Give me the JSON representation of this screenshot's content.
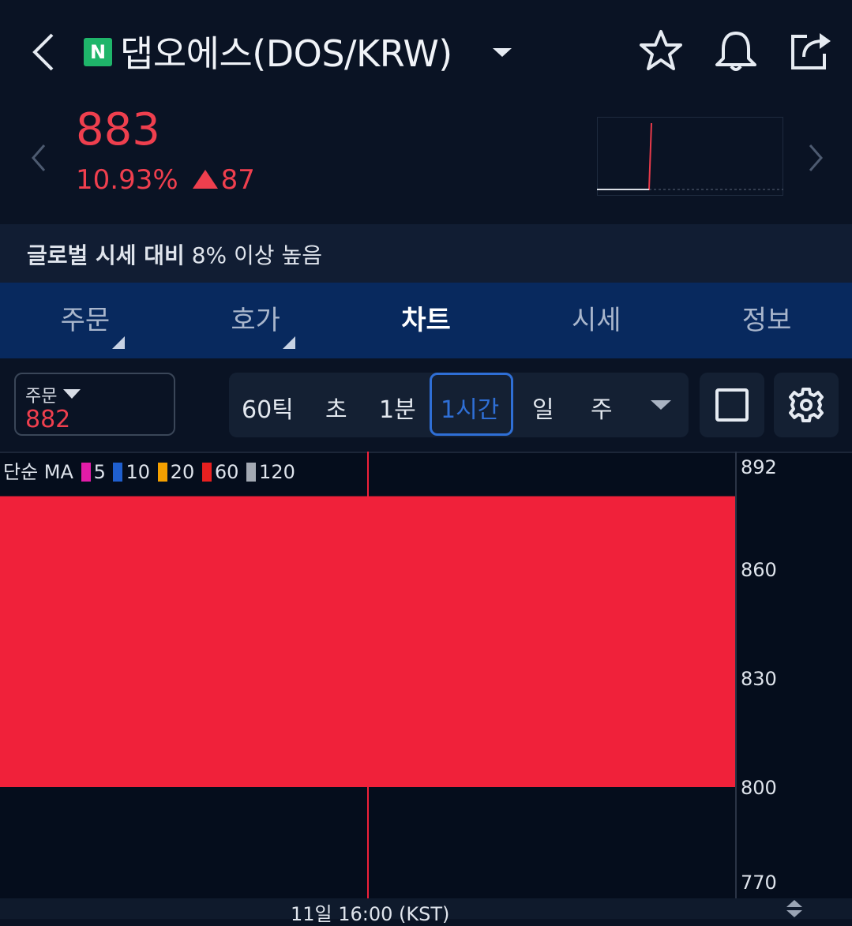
{
  "header": {
    "logo_text": "N",
    "title": "댑오에스(DOS/KRW)",
    "icons": [
      "back-arrow-icon",
      "chevron-down-icon",
      "star-icon",
      "bell-icon",
      "share-icon"
    ]
  },
  "price": {
    "current": "883",
    "change_pct": "10.93%",
    "change_abs": "87",
    "direction": "up",
    "color": "#ef3f4e"
  },
  "notice": {
    "bold": "글로벌 시세 대비",
    "rest": " 8% 이상 높음"
  },
  "tabs": [
    {
      "label": "주문",
      "active": false,
      "has_corner": true
    },
    {
      "label": "호가",
      "active": false,
      "has_corner": true
    },
    {
      "label": "차트",
      "active": true,
      "has_corner": false
    },
    {
      "label": "시세",
      "active": false,
      "has_corner": false
    },
    {
      "label": "정보",
      "active": false,
      "has_corner": false
    }
  ],
  "order_box": {
    "label": "주문",
    "value": "882"
  },
  "intervals": {
    "items": [
      "60틱",
      "초",
      "1분",
      "1시간",
      "일",
      "주"
    ],
    "selected": "1시간",
    "selected_color": "#2f6fd6"
  },
  "ma_legend": {
    "label": "단순 MA",
    "items": [
      {
        "period": "5",
        "color": "#e21ca8"
      },
      {
        "period": "10",
        "color": "#1f5fcf"
      },
      {
        "period": "20",
        "color": "#f5a000"
      },
      {
        "period": "60",
        "color": "#e82020"
      },
      {
        "period": "120",
        "color": "#a3a9b3"
      }
    ]
  },
  "chart_data": {
    "type": "candlestick",
    "y_ticks": [
      "892",
      "860",
      "830",
      "800",
      "770"
    ],
    "ylim": [
      770,
      892
    ],
    "x_label": "11일 16:00 (KST)",
    "candle": {
      "open": 800,
      "close": 883,
      "high": 892,
      "low": 770,
      "color": "#f0213a"
    },
    "grid": false
  }
}
